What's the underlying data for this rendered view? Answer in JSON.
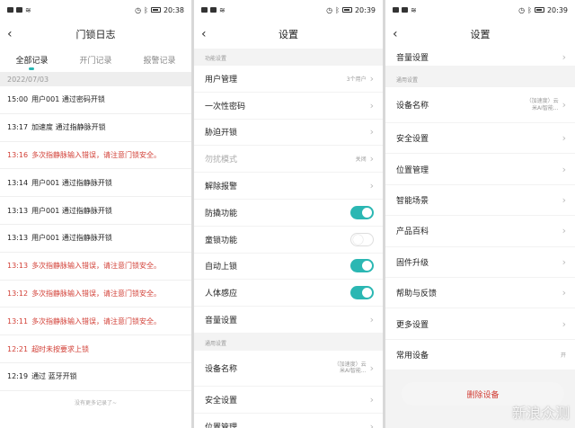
{
  "status": {
    "time1": "20:38",
    "time2": "20:39",
    "time3": "20:39"
  },
  "log": {
    "title": "门锁日志",
    "tabs": [
      "全部记录",
      "开门记录",
      "报警记录"
    ],
    "date": "2022/07/03",
    "rows": [
      {
        "time": "15:00",
        "text": "用户001 通过密码开锁",
        "alert": false
      },
      {
        "time": "13:17",
        "text": "加速度 通过指静脉开锁",
        "alert": false
      },
      {
        "time": "13:16",
        "text": "多次指静脉输入错误，请注意门锁安全。",
        "alert": true
      },
      {
        "time": "13:14",
        "text": "用户001 通过指静脉开锁",
        "alert": false
      },
      {
        "time": "13:13",
        "text": "用户001 通过指静脉开锁",
        "alert": false
      },
      {
        "time": "13:13",
        "text": "用户001 通过指静脉开锁",
        "alert": false
      },
      {
        "time": "13:13",
        "text": "多次指静脉输入错误，请注意门锁安全。",
        "alert": true
      },
      {
        "time": "13:12",
        "text": "多次指静脉输入错误，请注意门锁安全。",
        "alert": true
      },
      {
        "time": "13:11",
        "text": "多次指静脉输入错误，请注意门锁安全。",
        "alert": true
      },
      {
        "time": "12:21",
        "text": "超时未按要求上锁",
        "alert": true
      },
      {
        "time": "12:19",
        "text": "通过 蓝牙开锁",
        "alert": false
      }
    ],
    "more": "没有更多记录了~"
  },
  "settings1": {
    "title": "设置",
    "section1": "功能设置",
    "section2": "通用设置",
    "rows1": [
      {
        "label": "用户管理",
        "value": "3个用户",
        "type": "chevron"
      },
      {
        "label": "一次性密码",
        "value": "",
        "type": "chevron"
      },
      {
        "label": "胁迫开锁",
        "value": "",
        "type": "chevron"
      },
      {
        "label": "勿扰模式",
        "value": "关闭",
        "type": "chevron",
        "disabled": true
      },
      {
        "label": "解除报警",
        "value": "",
        "type": "chevron"
      },
      {
        "label": "防撬功能",
        "value": "",
        "type": "toggle",
        "on": true
      },
      {
        "label": "童锁功能",
        "value": "",
        "type": "toggle",
        "on": false
      },
      {
        "label": "自动上锁",
        "value": "",
        "type": "toggle",
        "on": true
      },
      {
        "label": "人体感应",
        "value": "",
        "type": "toggle",
        "on": true
      },
      {
        "label": "音量设置",
        "value": "",
        "type": "chevron"
      }
    ],
    "rows2": [
      {
        "label": "设备名称",
        "value": "（加速度）云\n米AI智能..."
      },
      {
        "label": "安全设置",
        "value": ""
      },
      {
        "label": "位置管理",
        "value": ""
      }
    ]
  },
  "settings2": {
    "title": "设置",
    "top_row": "音量设置",
    "section": "通用设置",
    "rows": [
      {
        "label": "设备名称",
        "value": "（加速度）云\n米AI智能..."
      },
      {
        "label": "安全设置",
        "value": ""
      },
      {
        "label": "位置管理",
        "value": ""
      },
      {
        "label": "智能场景",
        "value": ""
      },
      {
        "label": "产品百科",
        "value": ""
      },
      {
        "label": "固件升级",
        "value": ""
      },
      {
        "label": "帮助与反馈",
        "value": ""
      },
      {
        "label": "更多设置",
        "value": ""
      },
      {
        "label": "常用设备",
        "value": "开"
      }
    ],
    "delete": "删除设备"
  },
  "watermark": "新浪众测",
  "colors": {
    "accent": "#2bb7b3",
    "alert": "#d23f36"
  }
}
